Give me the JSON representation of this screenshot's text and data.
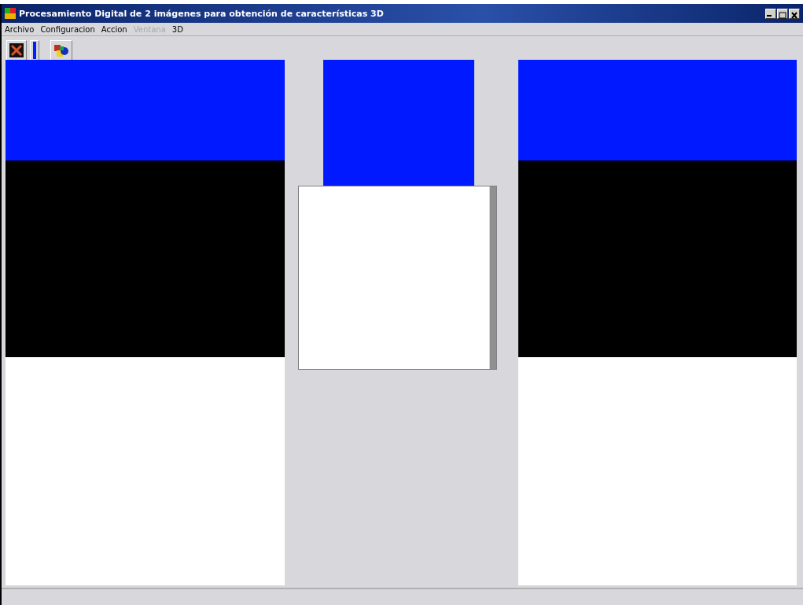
{
  "window": {
    "title": "Procesamiento Digital de 2 imágenes para obtención de características 3D"
  },
  "menu": [
    {
      "label": "Archivo",
      "disabled": false
    },
    {
      "label": "Configuracion",
      "disabled": false
    },
    {
      "label": "Accion",
      "disabled": false
    },
    {
      "label": "Ventana",
      "disabled": true
    },
    {
      "label": "3D",
      "disabled": false
    }
  ],
  "toolbar": [
    {
      "kind": "close"
    },
    {
      "kind": "separator"
    },
    {
      "kind": "color"
    }
  ]
}
